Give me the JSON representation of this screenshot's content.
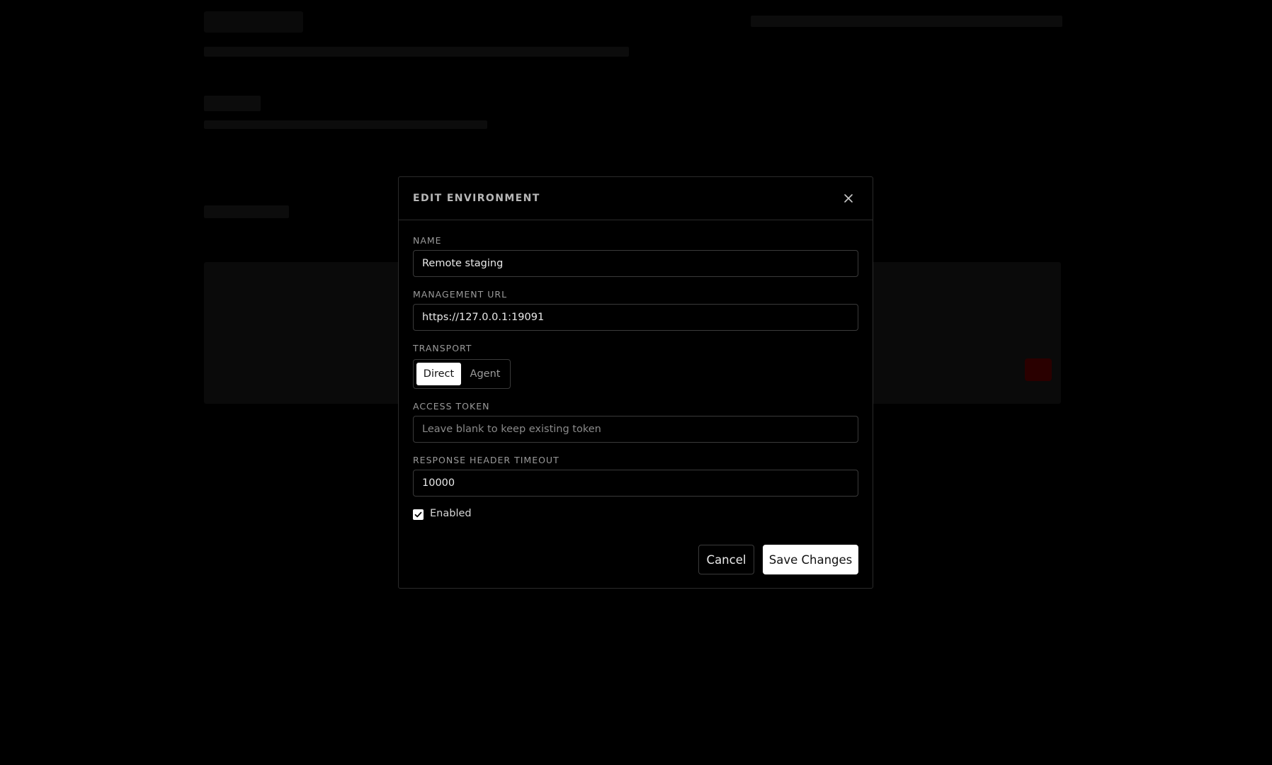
{
  "modal": {
    "title": "EDIT ENVIRONMENT",
    "close_icon": "close-icon"
  },
  "fields": {
    "name_label": "NAME",
    "name_value": "Remote staging",
    "url_label": "MANAGEMENT URL",
    "url_value": "https://127.0.0.1:19091",
    "transport_label": "TRANSPORT",
    "transport_options": [
      "Direct",
      "Agent"
    ],
    "transport_selected": "Direct",
    "token_label": "ACCESS TOKEN",
    "token_value": "",
    "token_placeholder": "Leave blank to keep existing token",
    "timeout_label": "RESPONSE HEADER TIMEOUT",
    "timeout_value": "10000",
    "enabled_label": "Enabled",
    "enabled_checked": true
  },
  "actions": {
    "cancel_label": "Cancel",
    "save_label": "Save Changes"
  },
  "colors": {
    "background": "#000000",
    "modal_border": "#2b2b2b",
    "primary_button": "#ffffff",
    "danger_dimmed": "#2a0000"
  }
}
